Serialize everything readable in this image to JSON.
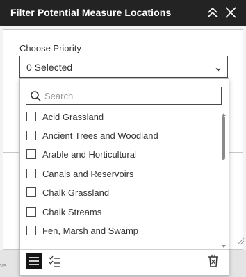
{
  "header": {
    "title": "Filter Potential Measure Locations"
  },
  "priority": {
    "label": "Choose Priority",
    "selected": "0 Selected"
  },
  "search": {
    "placeholder": "Search"
  },
  "items": [
    "Acid Grassland",
    "Ancient Trees and Woodland",
    "Arable and Horticultural",
    "Canals and Reservoirs",
    "Chalk Grassland",
    "Chalk Streams",
    "Fen, Marsh and Swamp"
  ],
  "map": {
    "partial_label": "vs"
  },
  "icons": {
    "collapse": "chevrons-up-icon",
    "close": "close-icon",
    "chevron": "chevron-down-icon",
    "search": "search-icon",
    "list": "list-icon",
    "checklist": "checklist-icon",
    "trash": "trash-icon"
  },
  "colors": {
    "header_bg": "#232323",
    "header_text": "#ffffff",
    "text": "#323232"
  }
}
